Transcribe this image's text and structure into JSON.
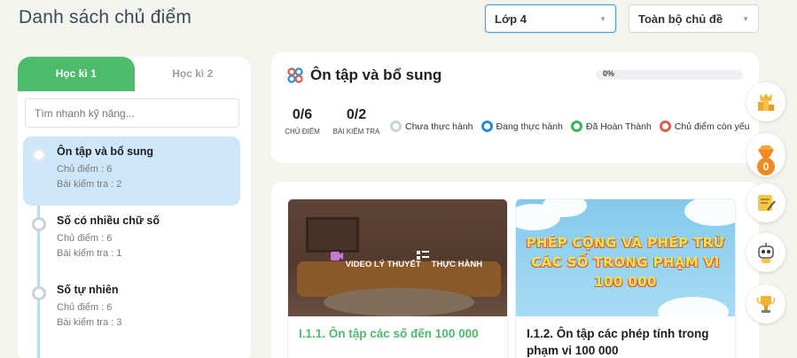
{
  "page": {
    "title": "Danh sách chủ điểm"
  },
  "filters": {
    "grade": "Lớp 4",
    "topic": "Toàn bộ chủ đề"
  },
  "tabs": [
    {
      "label": "Học kì 1",
      "active": true
    },
    {
      "label": "Học kì 2",
      "active": false
    }
  ],
  "search": {
    "placeholder": "Tìm nhanh kỹ năng..."
  },
  "skills": [
    {
      "name": "Ôn tập và bổ sung",
      "topics": "Chủ điểm : 6",
      "tests": "Bài kiểm tra : 2",
      "active": true
    },
    {
      "name": "Số có nhiều chữ số",
      "topics": "Chủ điểm : 6",
      "tests": "Bài kiểm tra : 1",
      "active": false
    },
    {
      "name": "Số tự nhiên",
      "topics": "Chủ điểm : 6",
      "tests": "Bài kiểm tra : 3",
      "active": false
    }
  ],
  "summary": {
    "title": "Ôn tập và bổ sung",
    "progress_label": "0%",
    "progress_value": 0,
    "topics_count": "0/6",
    "topics_label": "Chủ điểm",
    "tests_count": "0/2",
    "tests_label": "Bài kiểm tra"
  },
  "legend": [
    {
      "label": "Chưa thực hành",
      "color": "#c9d2d8"
    },
    {
      "label": "Đang thực hành",
      "color": "#1e8fd6"
    },
    {
      "label": "Đã Hoàn Thành",
      "color": "#3cb35a"
    },
    {
      "label": "Chủ điểm còn yếu",
      "color": "#e55a4a"
    }
  ],
  "lessons": [
    {
      "title": "I.1.1. Ôn tập các số đến 100 000",
      "video_label": "VIDEO LÝ THUYẾT",
      "practice_label": "THỰC HÀNH"
    },
    {
      "title": "I.1.2. Ôn tập các phép tính trong phạm vi 100 000",
      "banner": [
        "PHÉP CỘNG VÀ PHÉP TRỪ",
        "CÁC SỐ TRONG PHẠM VI",
        "100 000"
      ]
    }
  ],
  "side_icons": [
    "ranking-icon",
    "gem-icon",
    "certificate-icon",
    "robot-icon",
    "trophy-icon"
  ],
  "gem_count": "0"
}
